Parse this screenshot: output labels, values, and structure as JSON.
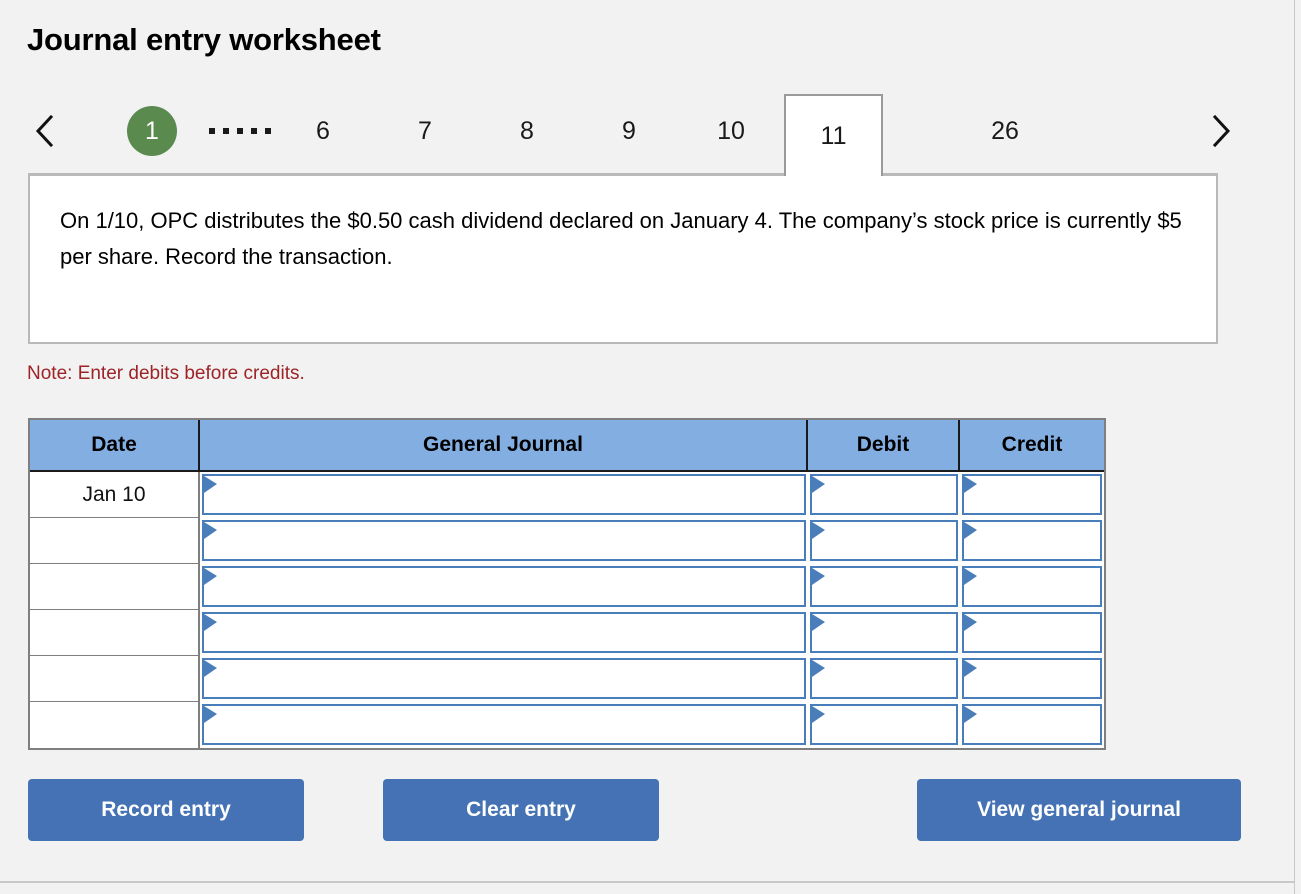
{
  "page": {
    "title": "Journal entry worksheet"
  },
  "pager": {
    "prev_label": "‹",
    "next_label": "›",
    "current": "1",
    "ellipsis": ".....",
    "items": [
      {
        "label": "6",
        "active": false
      },
      {
        "label": "7",
        "active": false
      },
      {
        "label": "8",
        "active": false
      },
      {
        "label": "9",
        "active": false
      },
      {
        "label": "10",
        "active": false
      },
      {
        "label": "11",
        "active": true
      },
      {
        "label": "26",
        "active": false
      }
    ]
  },
  "scenario": {
    "text": "On 1/10, OPC distributes the $0.50 cash dividend declared on January 4. The company’s stock price is currently $5 per share. Record the transaction."
  },
  "note": {
    "text": "Note: Enter debits before credits."
  },
  "table": {
    "headers": {
      "date": "Date",
      "general_journal": "General Journal",
      "debit": "Debit",
      "credit": "Credit"
    },
    "rows": [
      {
        "date": "Jan 10",
        "general_journal": "",
        "debit": "",
        "credit": ""
      },
      {
        "date": "",
        "general_journal": "",
        "debit": "",
        "credit": ""
      },
      {
        "date": "",
        "general_journal": "",
        "debit": "",
        "credit": ""
      },
      {
        "date": "",
        "general_journal": "",
        "debit": "",
        "credit": ""
      },
      {
        "date": "",
        "general_journal": "",
        "debit": "",
        "credit": ""
      },
      {
        "date": "",
        "general_journal": "",
        "debit": "",
        "credit": ""
      }
    ]
  },
  "buttons": {
    "record": "Record entry",
    "clear": "Clear entry",
    "view": "View general journal"
  },
  "colors": {
    "page_background": "#f2f2f2",
    "header_blue": "#82aee2",
    "button_blue": "#4472b4",
    "input_border_blue": "#4a7ebb",
    "current_page_green": "#5a8a4e",
    "note_red": "#9d2326",
    "table_border_gray": "#7f7f7f"
  }
}
